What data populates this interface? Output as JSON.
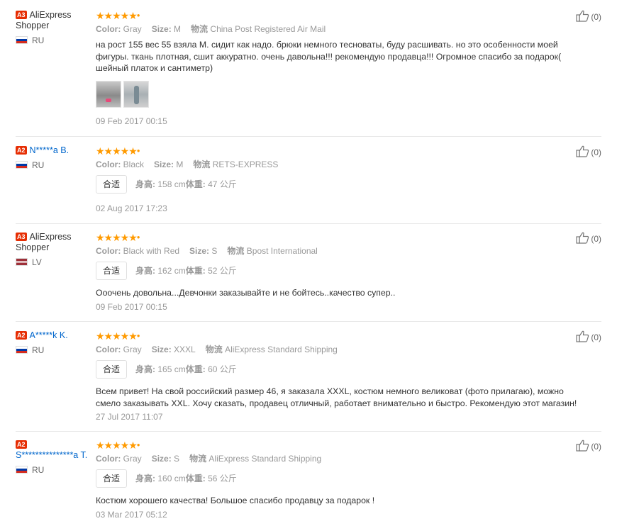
{
  "reviews": [
    {
      "level": "A3",
      "user": "AliExpress Shopper",
      "country": "RU",
      "color_label": "Color:",
      "color": "Gray",
      "size_label": "Size:",
      "size": "M",
      "ship_label": "物流",
      "shipping": "China Post Registered Air Mail",
      "text": "на рост 155 вес 55 взяла M. сидит как надо. брюки немного тесноваты, буду расшивать. но это особенности моей фигуры. ткань плотная, сшит аккуратно. очень давольна!!! рекомендую продавца!!! Огромное спасибо за подарок( шейный платок и сантиметр)",
      "date": "09 Feb 2017 00:15",
      "likes": "(0)"
    },
    {
      "level": "A2",
      "user": "N*****a B.",
      "country": "RU",
      "color_label": "Color:",
      "color": "Black",
      "size_label": "Size:",
      "size": "M",
      "ship_label": "物流",
      "shipping": "RETS-EXPRESS",
      "fit": "合适",
      "height_label": "身高:",
      "height": "158 cm",
      "weight_label": "体重:",
      "weight": "47 公斤",
      "date": "02 Aug 2017 17:23",
      "likes": "(0)"
    },
    {
      "level": "A3",
      "user": "AliExpress Shopper",
      "country": "LV",
      "color_label": "Color:",
      "color": "Black with Red",
      "size_label": "Size:",
      "size": "S",
      "ship_label": "物流",
      "shipping": "Bpost International",
      "fit": "合适",
      "height_label": "身高:",
      "height": "162 cm",
      "weight_label": "体重:",
      "weight": "52 公斤",
      "text": "Ооочень довольна...Девчонки заказывайте и не бойтесь..качество супер..",
      "date": "09 Feb 2017 00:15",
      "likes": "(0)"
    },
    {
      "level": "A2",
      "user": "A*****k K.",
      "country": "RU",
      "color_label": "Color:",
      "color": "Gray",
      "size_label": "Size:",
      "size": "XXXL",
      "ship_label": "物流",
      "shipping": "AliExpress Standard Shipping",
      "fit": "合适",
      "height_label": "身高:",
      "height": "165 cm",
      "weight_label": "体重:",
      "weight": "60 公斤",
      "text": "Всем привет! На свой российский размер 46, я заказала XXXL, костюм немного великоват (фото прилагаю), можно смело заказывать XXL. Хочу сказать, продавец отличный, работает внимательно и быстро. Рекомендую этот магазин!",
      "date": "27 Jul 2017 11:07",
      "likes": "(0)"
    },
    {
      "level": "A2",
      "user": "S***************a T.",
      "country": "RU",
      "color_label": "Color:",
      "color": "Gray",
      "size_label": "Size:",
      "size": "S",
      "ship_label": "物流",
      "shipping": "AliExpress Standard Shipping",
      "fit": "合适",
      "height_label": "身高:",
      "height": "160 cm",
      "weight_label": "体重:",
      "weight": "56 公斤",
      "text": "Костюм хорошего качества! Большое спасибо продавцу за подарок !",
      "date": "03 Mar 2017 05:12",
      "likes": "(0)"
    }
  ],
  "icons": {
    "rating": "five-star-rating",
    "like": "thumbs-up-icon",
    "flag": "country-flag-icon"
  },
  "colors": {
    "star": "#ff9a00",
    "level_badge": "#e62e04",
    "link": "#0066cc",
    "muted": "#999999"
  }
}
